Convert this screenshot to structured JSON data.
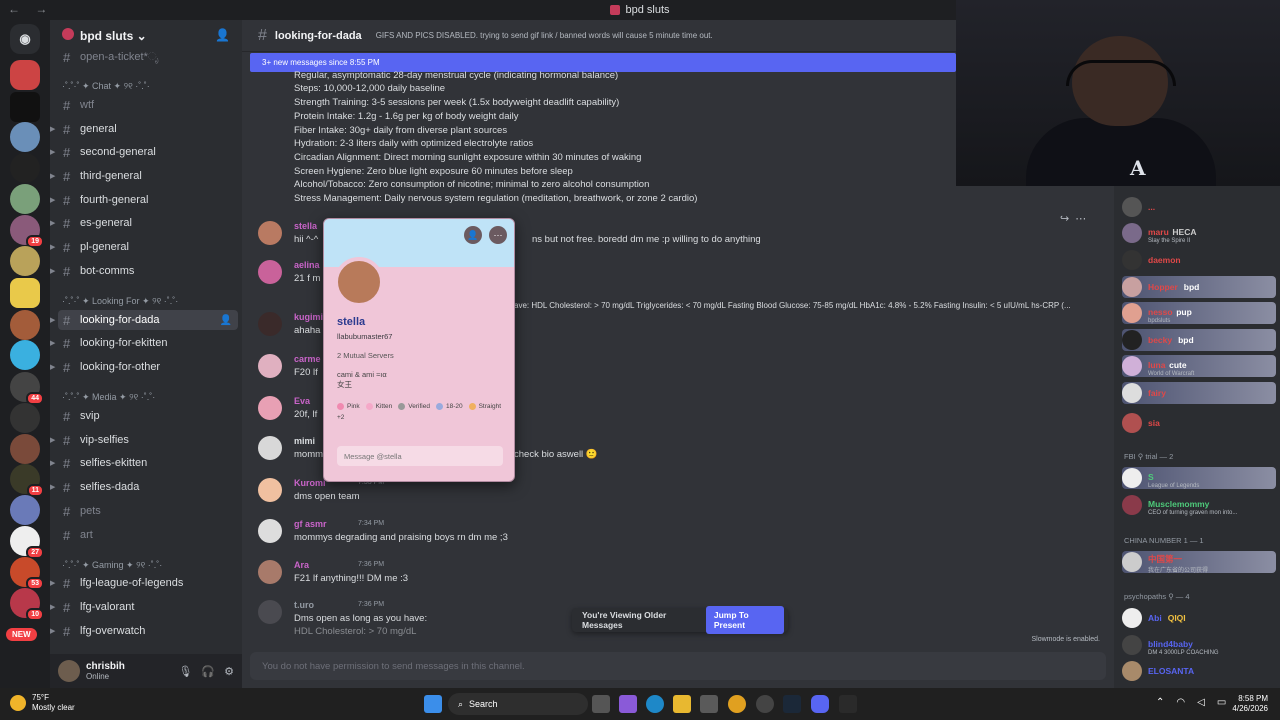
{
  "window": {
    "title": "bpd sluts",
    "nav": "← →"
  },
  "server": {
    "name": "bpd sluts"
  },
  "categories": {
    "chat": "·˚.˚·˚ ✦ Chat ✦ ୨୧ ·˚.˚·",
    "looking": "·˚.˚·˚ ✦ Looking For ✦ ୨୧ ·˚.˚·",
    "media": "·˚.˚·˚ ✦ Media ✦ ୨୧ ·˚.˚·",
    "gaming": "·˚.˚·˚ ✦ Gaming ✦ ୨୧ ·˚.˚·"
  },
  "channels": {
    "open_ticket": "open-a-ticket*ೃ",
    "wtf": "wtf",
    "general": "general",
    "second_general": "second-general",
    "third_general": "third-general",
    "fourth_general": "fourth-general",
    "es_general": "es-general",
    "pl_general": "pl-general",
    "bot_comms": "bot-comms",
    "looking_for_dada": "looking-for-dada",
    "looking_for_ekitten": "looking-for-ekitten",
    "looking_for_other": "looking-for-other",
    "svip": "svip",
    "vip_selfies": "vip-selfies",
    "selfies_ekitten": "selfies-ekitten",
    "selfies_dada": "selfies-dada",
    "pets": "pets",
    "art": "art",
    "lfg_lol": "lfg-league-of-legends",
    "lfg_valorant": "lfg-valorant",
    "lfg_overwatch": "lfg-overwatch"
  },
  "server_badges": {
    "b1": "19",
    "b2": "44",
    "b3": "11",
    "b4": "27",
    "b5": "53",
    "b6": "10",
    "new": "NEW"
  },
  "user": {
    "name": "chrisbih",
    "status": "Online"
  },
  "channel_header": {
    "name": "looking-for-dada",
    "topic": "GIFS AND PICS DISABLED. trying to send gif link / banned words will cause 5 minute time out."
  },
  "new_messages_bar": "3+ new messages since 8:55 PM",
  "body_lines": [
    "Regular, asymptomatic 28-day menstrual cycle (indicating hormonal balance)",
    "Steps: 10,000-12,000 daily baseline",
    "Strength Training: 3-5 sessions per week (1.5x bodyweight deadlift capability)",
    "Protein Intake: 1.2g - 1.6g per kg of body weight daily",
    "Fiber Intake: 30g+ daily from diverse plant sources",
    "Hydration: 2-3 liters daily with optimized electrolyte ratios",
    "Circadian Alignment: Direct morning sunlight exposure within 30 minutes of waking",
    "Screen Hygiene: Zero blue light exposure 60 minutes before sleep",
    "Alcohol/Tobacco: Zero consumption of nicotine; minimal to zero alcohol consumption",
    "Stress Management: Daily nervous system regulation (meditation, breathwork, or zone 2 cardio)"
  ],
  "messages": [
    {
      "name": "stella",
      "time": "",
      "text": "hii ^-^",
      "text2": "ns but not free. boredd dm me :p willing to do anything"
    },
    {
      "name": "aelina",
      "time": "",
      "text": "21 f m",
      "text2": ""
    },
    {
      "name": "kugimi",
      "time": "",
      "text": "ahaha",
      "text2": "ave: HDL Cholesterol: > 70 mg/dL Triglycerides: < 70 mg/dL Fasting Blood Glucose: 75-85 mg/dL HbA1c: 4.8% - 5.2% Fasting Insulin: < 5 uIU/mL hs-CRP (..."
    },
    {
      "name": "carme",
      "time": "",
      "text": "F20 lf",
      "text2": ""
    },
    {
      "name": "Eva",
      "time": "",
      "text": "20f, lf",
      "text2": ""
    },
    {
      "name": "mimi",
      "time": "",
      "text": "momm",
      "text2": "check bio aswell 🙂"
    },
    {
      "name": "Kuromi",
      "time": "7:33 PM",
      "text": "dms open team",
      "text2": ""
    },
    {
      "name": "gf asmr",
      "time": "7:34 PM",
      "text": "mommys degrading and praising boys rn dm me ;3",
      "text2": ""
    },
    {
      "name": "Ara",
      "time": "7:36 PM",
      "text": "F21 lf anything!!! DM me :3",
      "text2": ""
    },
    {
      "name": "t.uro",
      "time": "7:36 PM",
      "text": "Dms open as long as you have:",
      "text2": "HDL Cholesterol: > 70 mg/dL"
    }
  ],
  "older_bar": {
    "label": "You're Viewing Older Messages",
    "button": "Jump To Present"
  },
  "slowmode": "Slowmode is enabled.",
  "composer_placeholder": "You do not have permission to send messages in this channel.",
  "profile": {
    "display_name": "stella",
    "username": "llabubumaster67",
    "mutual": "2 Mutual Servers",
    "bio1": "cami & ami ≈ıα",
    "bio2": "女王",
    "tags": [
      "Pink",
      "Kitten",
      "Verified",
      "18-20",
      "Straight",
      "+2"
    ],
    "message_placeholder": "Message @stella"
  },
  "members": {
    "list1": [
      {
        "name": "...",
        "status": ""
      },
      {
        "name": "maru",
        "tag": "HECA",
        "status": "Slay the Spire II"
      },
      {
        "name": "daemon",
        "status": ""
      },
      {
        "name": "Hopper",
        "tag": "bpd",
        "status": ""
      },
      {
        "name": "nesso",
        "tag": "pup",
        "status": "bpdsluts"
      },
      {
        "name": "becky",
        "tag": "bpd",
        "status": ""
      },
      {
        "name": "luna",
        "tag": "cute",
        "status": "World of Warcraft"
      },
      {
        "name": "fairy",
        "status": ""
      },
      {
        "name": "sia",
        "status": ""
      }
    ],
    "group_fbi": "FBI ⚲ trial — 2",
    "list2": [
      {
        "name": "S",
        "status": "League of Legends"
      },
      {
        "name": "Musclemommy",
        "status": "CEO of turning graven mon into..."
      }
    ],
    "group_china": "CHINA NUMBER 1 — 1",
    "list3": [
      {
        "name": "中国第一",
        "status": "我在广东省的公司获得"
      }
    ],
    "group_psycho": "psychopaths ⚲ — 4",
    "list4": [
      {
        "name": "Abi",
        "tag": "QIQI",
        "status": ""
      },
      {
        "name": "blind4baby",
        "status": "DM 4 3000LP COACHING"
      },
      {
        "name": "ELOSANTA",
        "status": ""
      }
    ]
  },
  "taskbar": {
    "temp": "75°F",
    "weather": "Mostly clear",
    "search": "Search",
    "time": "8:58 PM",
    "date": "4/26/2026"
  },
  "colors": {
    "accent": "#5865f2",
    "name_pink": "#c964c9",
    "name_green": "#4ecb7b",
    "bg": "#313338"
  }
}
